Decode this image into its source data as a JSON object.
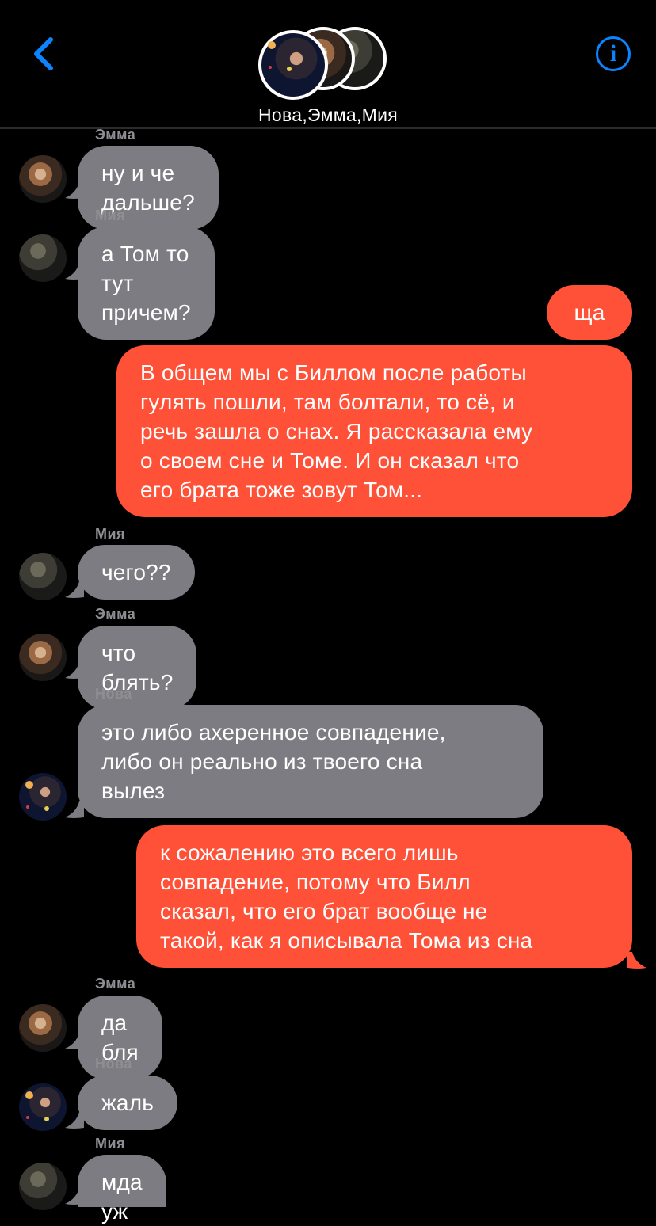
{
  "header": {
    "back_icon": "chevron-left-icon",
    "info_icon": "info-icon",
    "info_glyph": "i",
    "title": "Нова,Эмма,Мия",
    "accent_color": "#0a84ff"
  },
  "colors": {
    "incoming_bubble": "#7d7c82",
    "outgoing_bubble": "#ff5137",
    "background": "#000000",
    "sender_name": "#8e8e93"
  },
  "messages": [
    {
      "sender": "Эмма",
      "text": "ну и че дальше?",
      "direction": "incoming"
    },
    {
      "sender": "Мия",
      "text": "а Том то тут причем?",
      "direction": "incoming"
    },
    {
      "text": "ща",
      "direction": "outgoing"
    },
    {
      "text": "В общем мы с Биллом после работы\nгулять пошли, там болтали, то сё, и\nречь зашла о снах. Я рассказала ему\nо своем сне и Томе. И он сказал что\nего брата тоже зовут Том...",
      "direction": "outgoing"
    },
    {
      "sender": "Мия",
      "text": "чего??",
      "direction": "incoming"
    },
    {
      "sender": "Эмма",
      "text": "что блять?",
      "direction": "incoming"
    },
    {
      "sender": "Нова",
      "text": "это либо ахеренное совпадение,\nлибо он реально из твоего сна\nвылез",
      "direction": "incoming"
    },
    {
      "text": "к сожалению это всего лишь\nсовпадение, потому что Билл\nсказал, что его брат вообще не\nтакой, как я описывала Тома из сна",
      "direction": "outgoing"
    },
    {
      "sender": "Эмма",
      "text": "да бля",
      "direction": "incoming"
    },
    {
      "sender": "Нова",
      "text": "жаль",
      "direction": "incoming"
    },
    {
      "sender": "Мия",
      "text": "мда уж",
      "direction": "incoming"
    }
  ]
}
